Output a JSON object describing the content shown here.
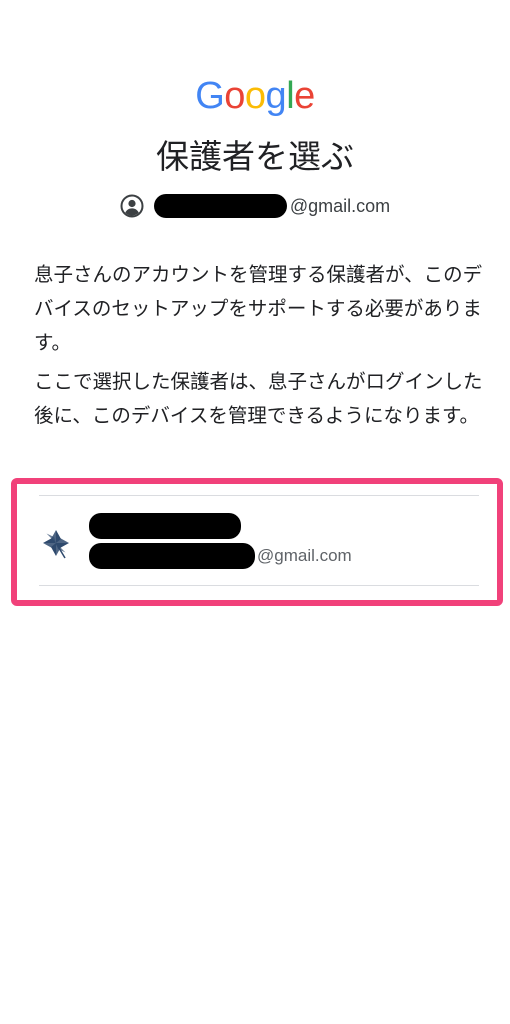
{
  "logo": {
    "letters": [
      {
        "char": "G",
        "color": "#4285F4"
      },
      {
        "char": "o",
        "color": "#EA4335"
      },
      {
        "char": "o",
        "color": "#FBBC05"
      },
      {
        "char": "g",
        "color": "#4285F4"
      },
      {
        "char": "l",
        "color": "#34A853"
      },
      {
        "char": "e",
        "color": "#EA4335"
      }
    ]
  },
  "title": "保護者を選ぶ",
  "account": {
    "icon": "account-circle-icon",
    "email_suffix": "@gmail.com"
  },
  "description": {
    "paragraph1": "息子さんのアカウントを管理する保護者が、このデバイスのセットアップをサポートする必要があります。",
    "paragraph2": "ここで選択した保護者は、息子さんがログインした後に、このデバイスを管理できるようになります。"
  },
  "guardians": [
    {
      "avatar_icon": "umbrella-avatar-icon",
      "email_suffix": "@gmail.com"
    }
  ],
  "colors": {
    "highlight_border": "#f1417a",
    "divider": "#dadce0",
    "avatar": "#2f4a6d"
  }
}
